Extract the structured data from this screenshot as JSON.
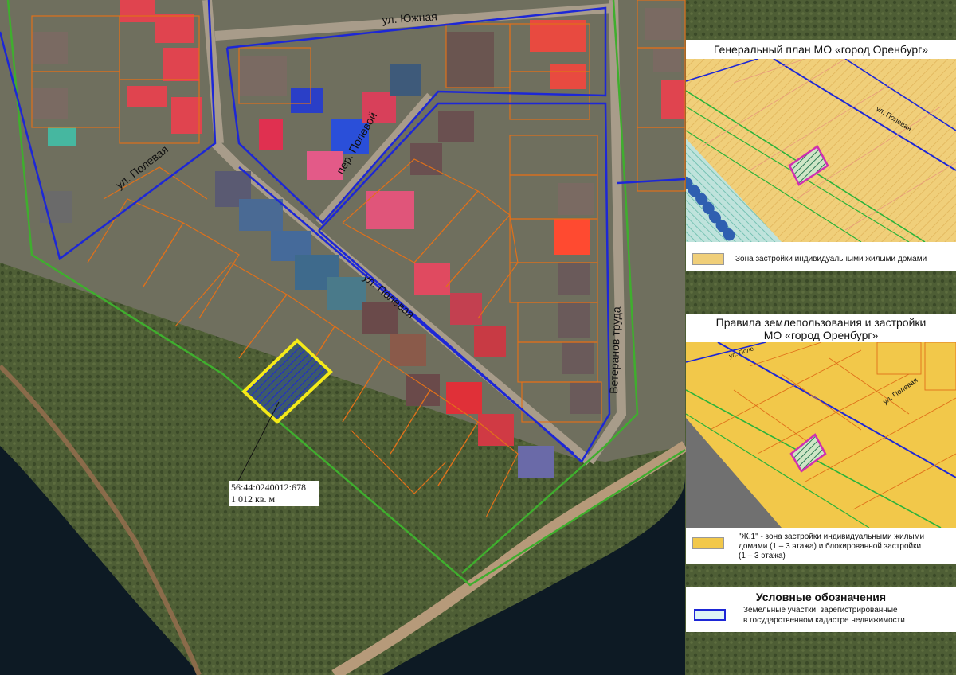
{
  "colors": {
    "vegetation": "#4e5e35",
    "urban": "#6f6f5e",
    "water": "#0d1a24",
    "road": "#a89c8a",
    "border_blue": "#1d27d6",
    "border_green": "#3fae2e",
    "parcel_orange": "#e0701a",
    "highlight_yellow": "#f5ea18",
    "zone_ivs": "#f0cf7a",
    "zone_zh1": "#f2c84a",
    "parcel_magenta": "#d02fb0"
  },
  "streets": {
    "yuzhnaya": "ул. Южная",
    "polevaya_north": "ул. Полевая",
    "polevaya_main": "ул. Полевая",
    "per_polevoy": "пер. Полевой",
    "veteranov_truda": "Ветеранов труда"
  },
  "parcel": {
    "cadastral_number": "56:44:0240012:678",
    "area": "1 012 кв. м"
  },
  "genplan_panel": {
    "title": "Генеральный план МО «город Оренбург»",
    "street_label": "ул. Полевая",
    "legend_label": "Зона застройки индивидуальными жилыми домами"
  },
  "pzz_panel": {
    "title_line1": "Правила землепользования и застройки",
    "title_line2": "МО «город Оренбург»",
    "street_label": "ул. Полевая",
    "street_label_2": "ул. Поле",
    "legend_label_line1": "\"Ж.1\" - зона застройки индивидуальными жилыми",
    "legend_label_line2": "домами (1 – 3 этажа) и блокированной застройки",
    "legend_label_line3": "(1 – 3 этажа)"
  },
  "legend_panel": {
    "title": "Условные обозначения",
    "item_line1": "Земельные участки, зарегистрированные",
    "item_line2": "в государственном кадастре недвижимости"
  }
}
